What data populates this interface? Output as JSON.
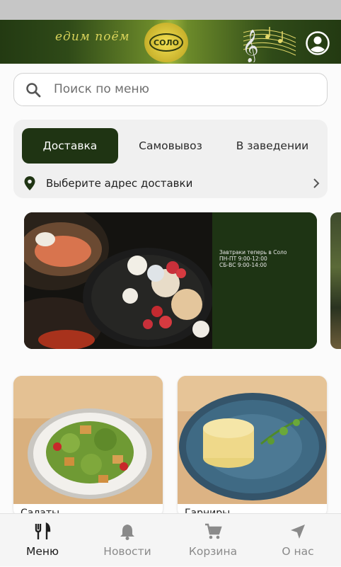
{
  "header": {
    "slogan": "едим поём",
    "logo_text": "СОЛО"
  },
  "search": {
    "placeholder": "Поиск по меню"
  },
  "order_modes": {
    "tabs": [
      {
        "label": "Доставка",
        "active": true
      },
      {
        "label": "Самовывоз",
        "active": false
      },
      {
        "label": "В заведении",
        "active": false
      }
    ],
    "address_prompt": "Выберите адрес доставки"
  },
  "banner": {
    "line1": "Завтраки теперь в Соло",
    "line2": "ПН-ПТ 9:00-12:00",
    "line3": "СБ-ВС 9:00-14:00"
  },
  "categories": [
    {
      "label": "Салаты"
    },
    {
      "label": "Гарниры"
    }
  ],
  "bottom_nav": {
    "items": [
      {
        "label": "Меню",
        "icon": "fork-knife-icon",
        "active": true
      },
      {
        "label": "Новости",
        "icon": "bell-icon",
        "active": false
      },
      {
        "label": "Корзина",
        "icon": "cart-icon",
        "active": false
      },
      {
        "label": "О нас",
        "icon": "navigation-arrow-icon",
        "active": false
      }
    ]
  },
  "colors": {
    "brand_dark_green": "#1f3413",
    "accent_gold": "#d7d25a"
  }
}
